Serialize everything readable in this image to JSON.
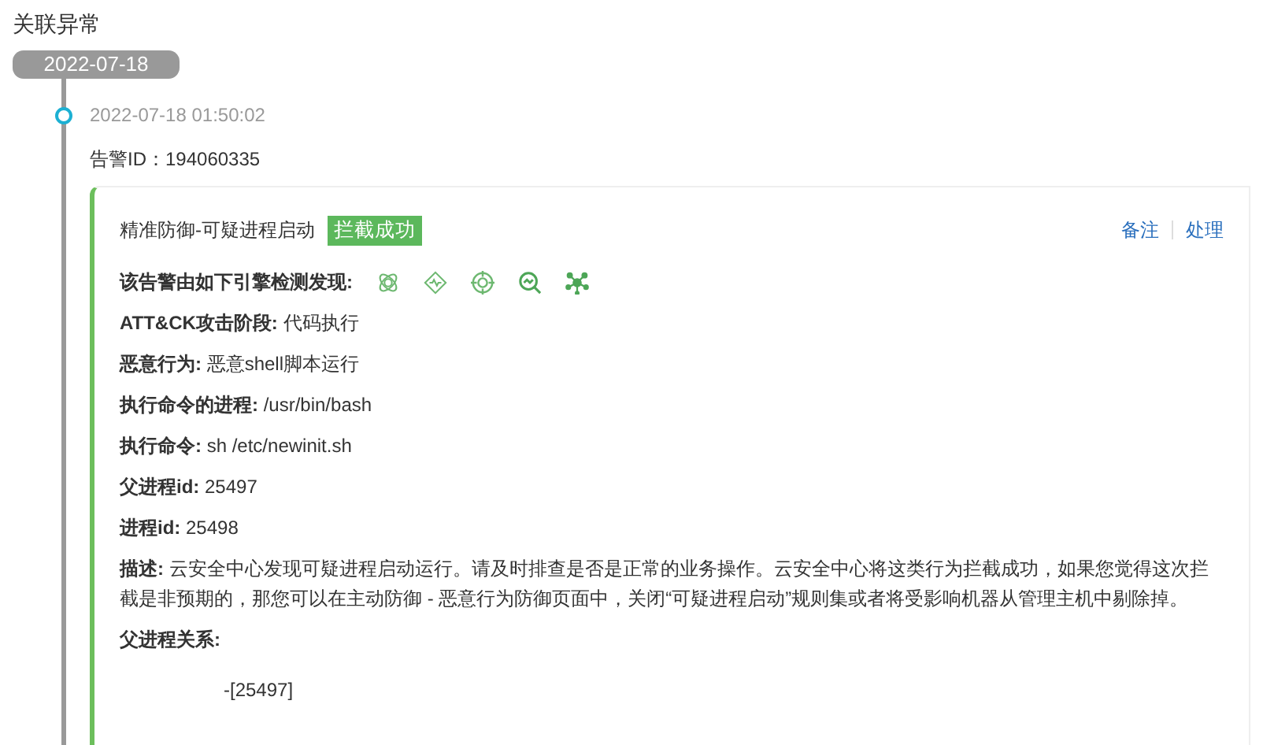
{
  "section_title": "关联异常",
  "date_badge": "2022-07-18",
  "event": {
    "time": "2022-07-18 01:50:02",
    "alert_id": "告警ID：194060335",
    "card": {
      "title": "精准防御-可疑进程启动",
      "status": "拦截成功",
      "actions": [
        "备注",
        "处理"
      ],
      "engines_label": "该告警由如下引擎检测发现:",
      "fields": [
        "**ATT&CK攻击阶段:** 代码执行",
        "**恶意行为:** 恶意shell脚本运行",
        "**执行命令的进程:** /usr/bin/bash",
        "**执行命令:** sh /etc/newinit.sh",
        "**父进程id:** 25497",
        "**进程id:** 25498",
        "**描述:** 云安全中心发现可疑进程启动运行。请及时排查是否是正常的业务操作。云安全中心将这类行为拦截成功，如果您觉得这次拦截是非预期的，那您可以在主动防御 - 恶意行为防御页面中，关闭“可疑进程启动”规则集或者将受影响机器从管理主机中剔除掉。"
      ],
      "relation_label": "父进程关系:",
      "relation_tree": "-[25497]"
    }
  }
}
